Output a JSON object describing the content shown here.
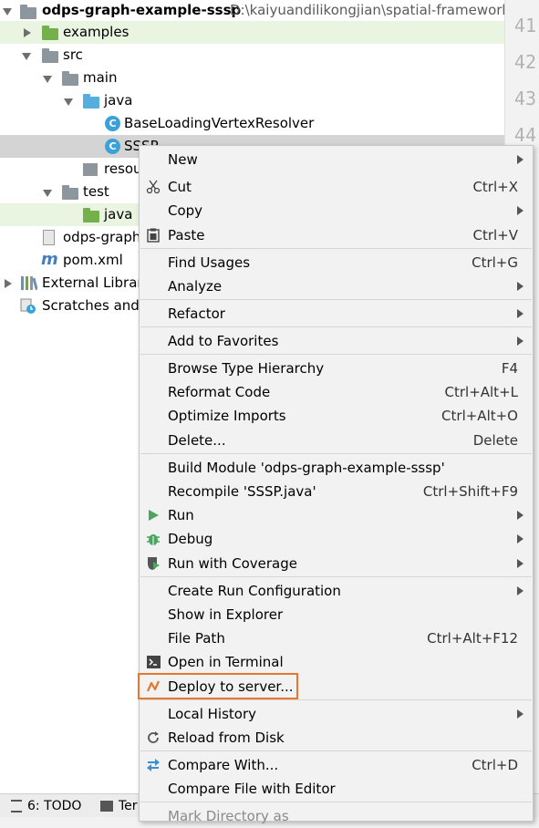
{
  "project_tree": {
    "root": {
      "label": "odps-graph-example-sssp",
      "path": "D:\\kaiyuandilikongjian\\spatial-framework-"
    },
    "items": [
      {
        "label": "examples"
      },
      {
        "label": "src"
      },
      {
        "label": "main"
      },
      {
        "label": "java"
      },
      {
        "label": "BaseLoadingVertexResolver"
      },
      {
        "label": "SSSP"
      },
      {
        "label": "resou"
      },
      {
        "label": "test"
      },
      {
        "label": "java"
      },
      {
        "label": "odps-graph"
      },
      {
        "label": "pom.xml"
      },
      {
        "label": "External Librari"
      },
      {
        "label": "Scratches and"
      }
    ],
    "class_icon_letter": "C",
    "maven_icon_letter": "m"
  },
  "gutter": {
    "line_numbers": [
      "41",
      "42",
      "43",
      "44"
    ]
  },
  "bottom_bar": {
    "todo": "6: TODO",
    "terminal": "Ter"
  },
  "context_menu": {
    "items": [
      {
        "label": "New",
        "shortcut": "",
        "icon": ""
      },
      {
        "label": "Cut",
        "shortcut": "Ctrl+X",
        "icon": "scissors-icon"
      },
      {
        "label": "Copy",
        "shortcut": "",
        "icon": ""
      },
      {
        "label": "Paste",
        "shortcut": "Ctrl+V",
        "icon": "clipboard-icon"
      },
      {
        "label": "Find Usages",
        "shortcut": "Ctrl+G",
        "icon": ""
      },
      {
        "label": "Analyze",
        "shortcut": "",
        "icon": ""
      },
      {
        "label": "Refactor",
        "shortcut": "",
        "icon": ""
      },
      {
        "label": "Add to Favorites",
        "shortcut": "",
        "icon": ""
      },
      {
        "label": "Browse Type Hierarchy",
        "shortcut": "F4",
        "icon": ""
      },
      {
        "label": "Reformat Code",
        "shortcut": "Ctrl+Alt+L",
        "icon": ""
      },
      {
        "label": "Optimize Imports",
        "shortcut": "Ctrl+Alt+O",
        "icon": ""
      },
      {
        "label": "Delete...",
        "shortcut": "Delete",
        "icon": ""
      },
      {
        "label": "Build Module 'odps-graph-example-sssp'",
        "shortcut": "",
        "icon": ""
      },
      {
        "label": "Recompile 'SSSP.java'",
        "shortcut": "Ctrl+Shift+F9",
        "icon": ""
      },
      {
        "label": "Run",
        "shortcut": "",
        "icon": "run-icon"
      },
      {
        "label": "Debug",
        "shortcut": "",
        "icon": "debug-icon"
      },
      {
        "label": "Run with Coverage",
        "shortcut": "",
        "icon": "coverage-icon"
      },
      {
        "label": "Create Run Configuration",
        "shortcut": "",
        "icon": ""
      },
      {
        "label": "Show in Explorer",
        "shortcut": "",
        "icon": ""
      },
      {
        "label": "File Path",
        "shortcut": "Ctrl+Alt+F12",
        "icon": ""
      },
      {
        "label": "Open in Terminal",
        "shortcut": "",
        "icon": "terminal-icon"
      },
      {
        "label": "Deploy to server...",
        "shortcut": "",
        "icon": "deploy-icon"
      },
      {
        "label": "Local History",
        "shortcut": "",
        "icon": ""
      },
      {
        "label": "Reload from Disk",
        "shortcut": "",
        "icon": "reload-icon"
      },
      {
        "label": "Compare With...",
        "shortcut": "Ctrl+D",
        "icon": "compare-icon"
      },
      {
        "label": "Compare File with Editor",
        "shortcut": "",
        "icon": ""
      },
      {
        "label": "Mark Directory as",
        "shortcut": "",
        "icon": ""
      }
    ]
  },
  "colors": {
    "highlight_box": "#e8772e",
    "selected_row": "#d4d4d4",
    "source_root_row": "#e9f5e1"
  }
}
